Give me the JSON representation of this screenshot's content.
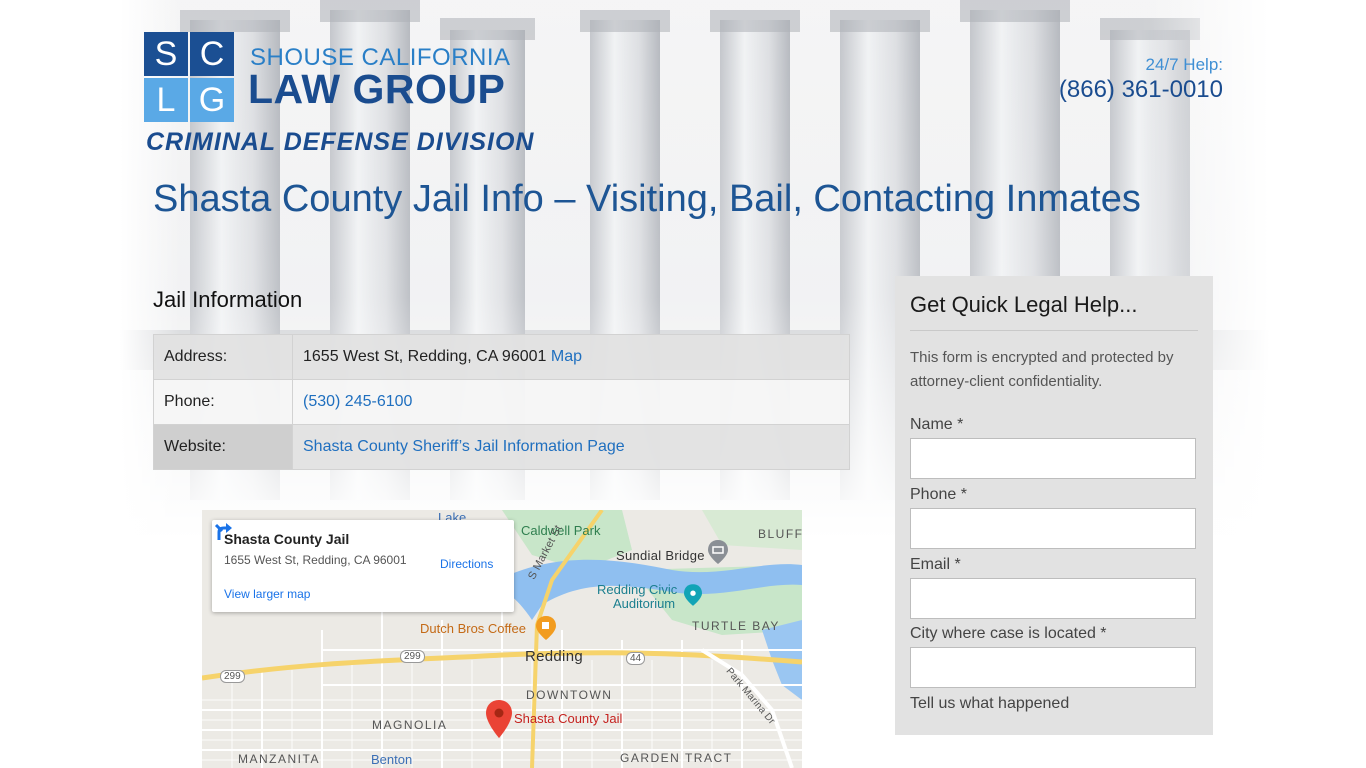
{
  "header": {
    "logo_letters": [
      "S",
      "C",
      "L",
      "G"
    ],
    "brand_top": "SHOUSE CALIFORNIA",
    "brand_main": "LAW GROUP",
    "division": "CRIMINAL DEFENSE DIVISION",
    "help_label": "24/7 Help:",
    "help_phone": "(866) 361-0010"
  },
  "page_title": "Shasta County Jail Info – Visiting, Bail, Contacting Inmates",
  "jail_info": {
    "title": "Jail Information",
    "rows": [
      {
        "key": "Address:",
        "value": "1655 West St, Redding, CA 96001",
        "link": "Map"
      },
      {
        "key": "Phone:",
        "value": "",
        "link": "(530) 245-6100"
      },
      {
        "key": "Website:",
        "value": "",
        "link": "Shasta County Sheriff’s Jail Information Page"
      }
    ]
  },
  "map": {
    "card": {
      "name": "Shasta County Jail",
      "address": "1655 West St, Redding, CA 96001",
      "directions": "Directions",
      "larger": "View larger map"
    },
    "labels": {
      "lake": "Lake",
      "caldwell": "Caldwell Park",
      "bluff": "BLUFF",
      "sundial": "Sundial Bridge",
      "market": "S Market St",
      "civic1": "Redding Civic",
      "civic2": "Auditorium",
      "turtle": "TURTLE BAY",
      "dutch": "Dutch Bros Coffee",
      "redding": "Redding",
      "r299a": "299",
      "r299b": "299",
      "r44": "44",
      "park_marina": "Park Marina Dr",
      "downtown": "DOWNTOWN",
      "magnolia": "MAGNOLIA",
      "jail": "Shasta County Jail",
      "manzanita": "MANZANITA",
      "benton": "Benton",
      "garden": "GARDEN TRACT"
    }
  },
  "form": {
    "title": "Get Quick Legal Help...",
    "note": "This form is encrypted and protected by attorney-client confidentiality.",
    "fields": {
      "name": "Name *",
      "phone": "Phone *",
      "email": "Email *",
      "city": "City where case is located *",
      "story": "Tell us what happened"
    }
  },
  "colors": {
    "brand_dark": "#1a4c8f",
    "brand_light": "#2a7fc7",
    "logo_dark": "#1b4f93",
    "logo_light": "#5aa9e6",
    "link": "#1f6fbf"
  }
}
